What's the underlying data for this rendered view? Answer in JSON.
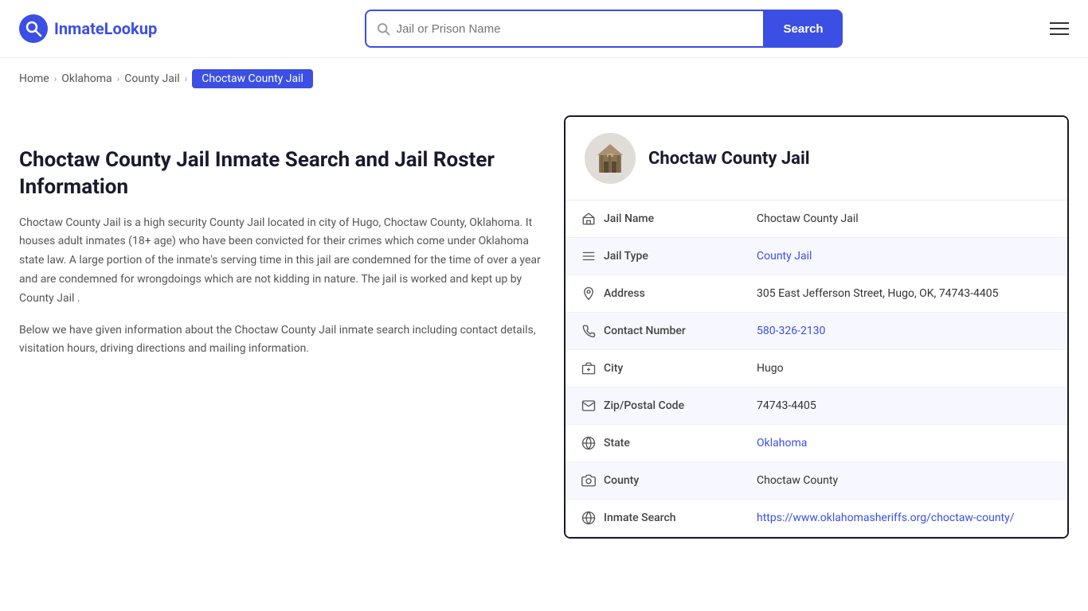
{
  "header": {
    "logo_text_part1": "Inmate",
    "logo_text_part2": "Lookup",
    "search_placeholder": "Jail or Prison Name",
    "search_button_label": "Search"
  },
  "breadcrumb": {
    "items": [
      {
        "label": "Home",
        "href": "#",
        "active": false
      },
      {
        "label": "Oklahoma",
        "href": "#",
        "active": false
      },
      {
        "label": "County Jail",
        "href": "#",
        "active": false
      },
      {
        "label": "Choctaw County Jail",
        "href": "#",
        "active": true
      }
    ]
  },
  "left": {
    "title": "Choctaw County Jail Inmate Search and Jail Roster Information",
    "desc1": "Choctaw County Jail is a high security County Jail located in city of Hugo, Choctaw County, Oklahoma. It houses adult inmates (18+ age) who have been convicted for their crimes which come under Oklahoma state law. A large portion of the inmate's serving time in this jail are condemned for the time of over a year and are condemned for wrongdoings which are not kidding in nature. The jail is worked and kept up by County Jail .",
    "desc2": "Below we have given information about the Choctaw County Jail inmate search including contact details, visitation hours, driving directions and mailing information."
  },
  "card": {
    "title": "Choctaw County Jail",
    "rows": [
      {
        "id": "jail-name",
        "icon": "🏛",
        "label": "Jail Name",
        "value": "Choctaw County Jail",
        "link": false,
        "href": ""
      },
      {
        "id": "jail-type",
        "icon": "☰",
        "label": "Jail Type",
        "value": "County Jail",
        "link": true,
        "href": "#"
      },
      {
        "id": "address",
        "icon": "📍",
        "label": "Address",
        "value": "305 East Jefferson Street, Hugo, OK, 74743-4405",
        "link": false,
        "href": ""
      },
      {
        "id": "contact-number",
        "icon": "📞",
        "label": "Contact Number",
        "value": "580-326-2130",
        "link": true,
        "href": "tel:5803262130"
      },
      {
        "id": "city",
        "icon": "🗺",
        "label": "City",
        "value": "Hugo",
        "link": false,
        "href": ""
      },
      {
        "id": "zip",
        "icon": "✉",
        "label": "Zip/Postal Code",
        "value": "74743-4405",
        "link": false,
        "href": ""
      },
      {
        "id": "state",
        "icon": "🌐",
        "label": "State",
        "value": "Oklahoma",
        "link": true,
        "href": "#"
      },
      {
        "id": "county",
        "icon": "📷",
        "label": "County",
        "value": "Choctaw County",
        "link": false,
        "href": ""
      },
      {
        "id": "inmate-search",
        "icon": "🌍",
        "label": "Inmate Search",
        "value": "https://www.oklahomasheriffs.org/choctaw-county/",
        "link": true,
        "href": "https://www.oklahomasheriffs.org/choctaw-county/"
      }
    ]
  }
}
